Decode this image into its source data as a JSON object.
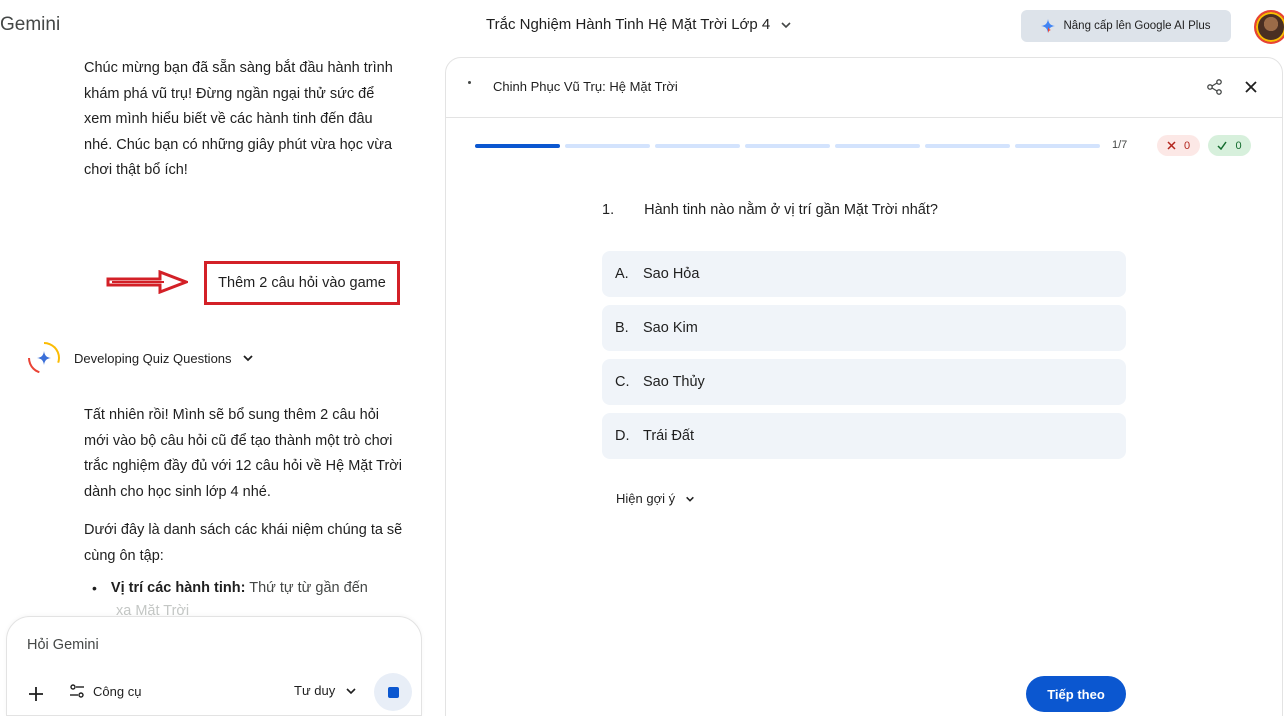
{
  "app": {
    "brand": "Gemini"
  },
  "topbar": {
    "title": "Trắc Nghiệm Hành Tinh Hệ Mặt Trời Lớp 4",
    "upgrade_label": "Nâng cấp lên Google AI Plus"
  },
  "chat": {
    "message1": "Chúc mừng bạn đã sẵn sàng bắt đầu hành trình khám phá vũ trụ! Đừng ngần ngại thử sức để xem mình hiểu biết về các hành tinh đến đâu nhé. Chúc bạn có những giây phút vừa học vừa chơi thật bổ ích!",
    "user_prompt": "Thêm 2 câu hỏi vào game",
    "thinking_label": "Developing Quiz Questions",
    "message2": "Tất nhiên rồi! Mình sẽ bổ sung thêm 2 câu hỏi mới vào bộ câu hỏi cũ để tạo thành một trò chơi trắc nghiệm đầy đủ với 12 câu hỏi về Hệ Mặt Trời dành cho học sinh lớp 4 nhé.",
    "message3": "Dưới đây là danh sách các khái niệm chúng ta sẽ cùng ôn tập:",
    "bullet_bold": "Vị trí các hành tinh:",
    "bullet_text": " Thứ tự từ gần đến",
    "fade_text": "xa Mặt Trời"
  },
  "composer": {
    "placeholder": "Hỏi Gemini",
    "tools_label": "Công cụ",
    "mode_label": "Tư duy"
  },
  "quiz": {
    "title": "Chinh Phục Vũ Trụ: Hệ Mặt Trời",
    "progress": {
      "current": 1,
      "total": 7,
      "label": "1/7"
    },
    "wrong_count": "0",
    "right_count": "0",
    "question_number": "1.",
    "question": "Hành tinh nào nằm ở vị trí gần Mặt Trời nhất?",
    "options": [
      {
        "letter": "A.",
        "text": "Sao Hỏa"
      },
      {
        "letter": "B.",
        "text": "Sao Kim"
      },
      {
        "letter": "C.",
        "text": "Sao Thủy"
      },
      {
        "letter": "D.",
        "text": "Trái Đất"
      }
    ],
    "hint_label": "Hiện gợi ý",
    "next_label": "Tiếp theo"
  },
  "colors": {
    "accent": "#0b57d0",
    "option_bg": "#f0f4f9",
    "highlight_box": "#d32027",
    "wrong_badge": "#fce8e6",
    "right_badge": "#d7f0dc"
  }
}
